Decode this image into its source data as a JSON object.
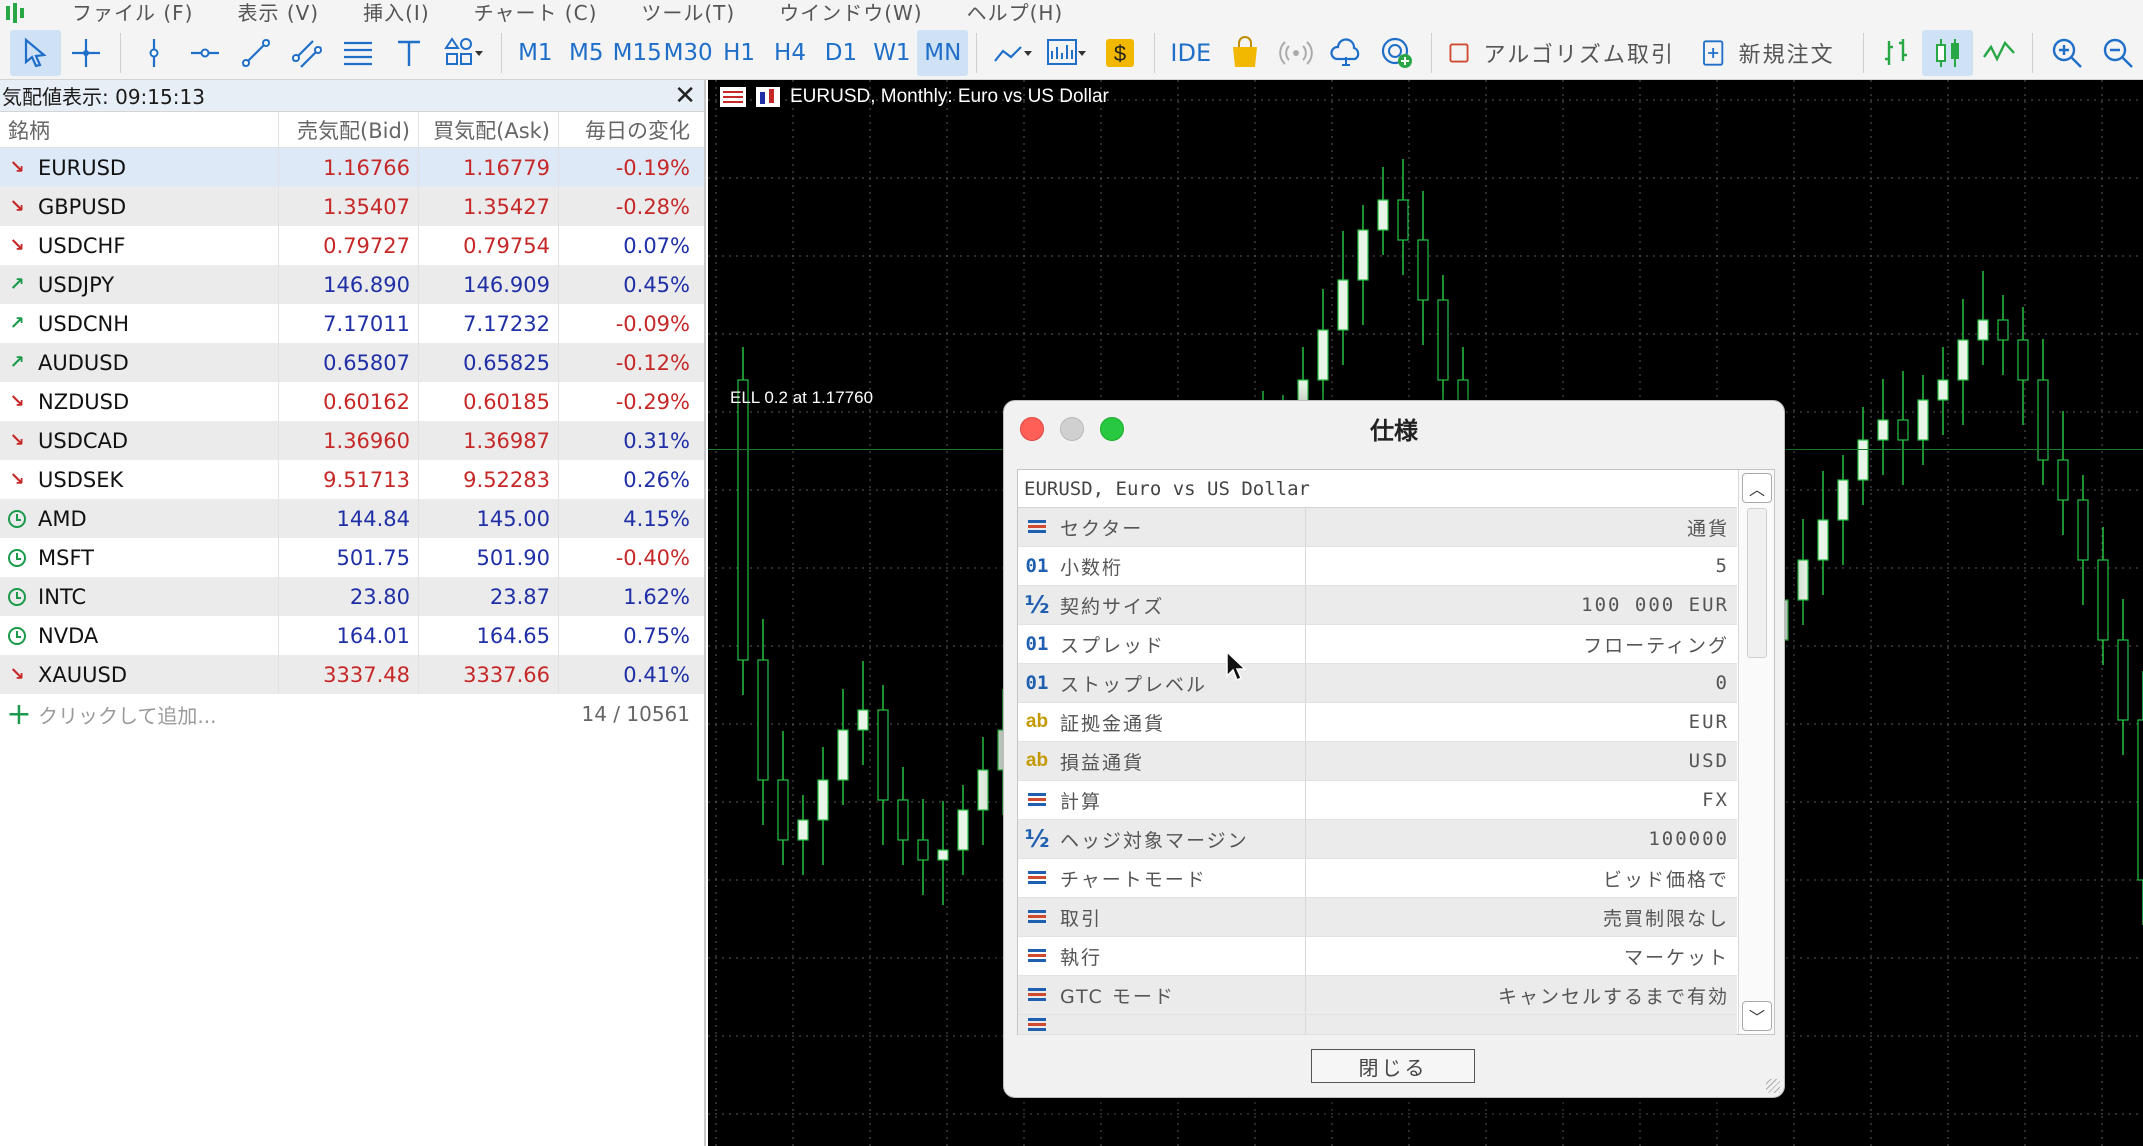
{
  "menu": [
    "ファイル (F)",
    "表示 (V)",
    "挿入(I)",
    "チャート (C)",
    "ツール(T)",
    "ウインドウ(W)",
    "ヘルプ(H)"
  ],
  "toolbar": {
    "timeframes": [
      "M1",
      "M5",
      "M15",
      "M30",
      "H1",
      "H4",
      "D1",
      "W1",
      "MN"
    ],
    "active_timeframe": "MN",
    "ide_label": "IDE",
    "algo_label": "アルゴリズム取引",
    "new_order_label": "新規注文"
  },
  "market_watch": {
    "title": "気配値表示: 09:15:13",
    "columns": [
      "銘柄",
      "売気配(Bid)",
      "買気配(Ask)",
      "毎日の変化"
    ],
    "rows": [
      {
        "symbol": "EURUSD",
        "bid": "1.16766",
        "ask": "1.16779",
        "change": "-0.19%",
        "icon": "arrow-down",
        "price_color": "red"
      },
      {
        "symbol": "GBPUSD",
        "bid": "1.35407",
        "ask": "1.35427",
        "change": "-0.28%",
        "icon": "arrow-down",
        "price_color": "red"
      },
      {
        "symbol": "USDCHF",
        "bid": "0.79727",
        "ask": "0.79754",
        "change": "0.07%",
        "icon": "arrow-down",
        "price_color": "red"
      },
      {
        "symbol": "USDJPY",
        "bid": "146.890",
        "ask": "146.909",
        "change": "0.45%",
        "icon": "arrow-up",
        "price_color": "blue"
      },
      {
        "symbol": "USDCNH",
        "bid": "7.17011",
        "ask": "7.17232",
        "change": "-0.09%",
        "icon": "arrow-up",
        "price_color": "blue"
      },
      {
        "symbol": "AUDUSD",
        "bid": "0.65807",
        "ask": "0.65825",
        "change": "-0.12%",
        "icon": "arrow-up",
        "price_color": "blue"
      },
      {
        "symbol": "NZDUSD",
        "bid": "0.60162",
        "ask": "0.60185",
        "change": "-0.29%",
        "icon": "arrow-down",
        "price_color": "red"
      },
      {
        "symbol": "USDCAD",
        "bid": "1.36960",
        "ask": "1.36987",
        "change": "0.31%",
        "icon": "arrow-down",
        "price_color": "red"
      },
      {
        "symbol": "USDSEK",
        "bid": "9.51713",
        "ask": "9.52283",
        "change": "0.26%",
        "icon": "arrow-down",
        "price_color": "red"
      },
      {
        "symbol": "AMD",
        "bid": "144.84",
        "ask": "145.00",
        "change": "4.15%",
        "icon": "clock",
        "price_color": "blue"
      },
      {
        "symbol": "MSFT",
        "bid": "501.75",
        "ask": "501.90",
        "change": "-0.40%",
        "icon": "clock",
        "price_color": "blue"
      },
      {
        "symbol": "INTC",
        "bid": "23.80",
        "ask": "23.87",
        "change": "1.62%",
        "icon": "clock",
        "price_color": "blue"
      },
      {
        "symbol": "NVDA",
        "bid": "164.01",
        "ask": "164.65",
        "change": "0.75%",
        "icon": "clock",
        "price_color": "blue"
      },
      {
        "symbol": "XAUUSD",
        "bid": "3337.48",
        "ask": "3337.66",
        "change": "0.41%",
        "icon": "arrow-down",
        "price_color": "red"
      }
    ],
    "add_label": "クリックして追加...",
    "count": "14 / 10561"
  },
  "chart": {
    "title": "EURUSD, Monthly:  Euro vs US Dollar",
    "order_label": "ELL 0.2 at 1.17760"
  },
  "dialog": {
    "title": "仕様",
    "header": "EURUSD, Euro vs US Dollar",
    "rows": [
      {
        "icon": "list",
        "name": "セクター",
        "value": "通貨"
      },
      {
        "icon": "num",
        "name": "小数桁",
        "value": "5"
      },
      {
        "icon": "frac",
        "name": "契約サイズ",
        "value": "100 000 EUR"
      },
      {
        "icon": "num",
        "name": "スプレッド",
        "value": "フローティング"
      },
      {
        "icon": "num",
        "name": "ストップレベル",
        "value": "0"
      },
      {
        "icon": "ab",
        "name": "証拠金通貨",
        "value": "EUR"
      },
      {
        "icon": "ab",
        "name": "損益通貨",
        "value": "USD"
      },
      {
        "icon": "list",
        "name": "計算",
        "value": "FX"
      },
      {
        "icon": "frac",
        "name": "ヘッジ対象マージン",
        "value": "100000"
      },
      {
        "icon": "list",
        "name": "チャートモード",
        "value": "ビッド価格で"
      },
      {
        "icon": "list",
        "name": "取引",
        "value": "売買制限なし"
      },
      {
        "icon": "list",
        "name": "執行",
        "value": "マーケット"
      },
      {
        "icon": "list",
        "name": "GTC モード",
        "value": "キャンセルするまで有効"
      }
    ],
    "close_label": "閉じる"
  },
  "colors": {
    "accent": "#1f6fc9",
    "bid_red": "#c62828",
    "bid_blue": "#1f2fa6",
    "selected_row": "#dde9f6",
    "chart_bg": "#000000"
  }
}
